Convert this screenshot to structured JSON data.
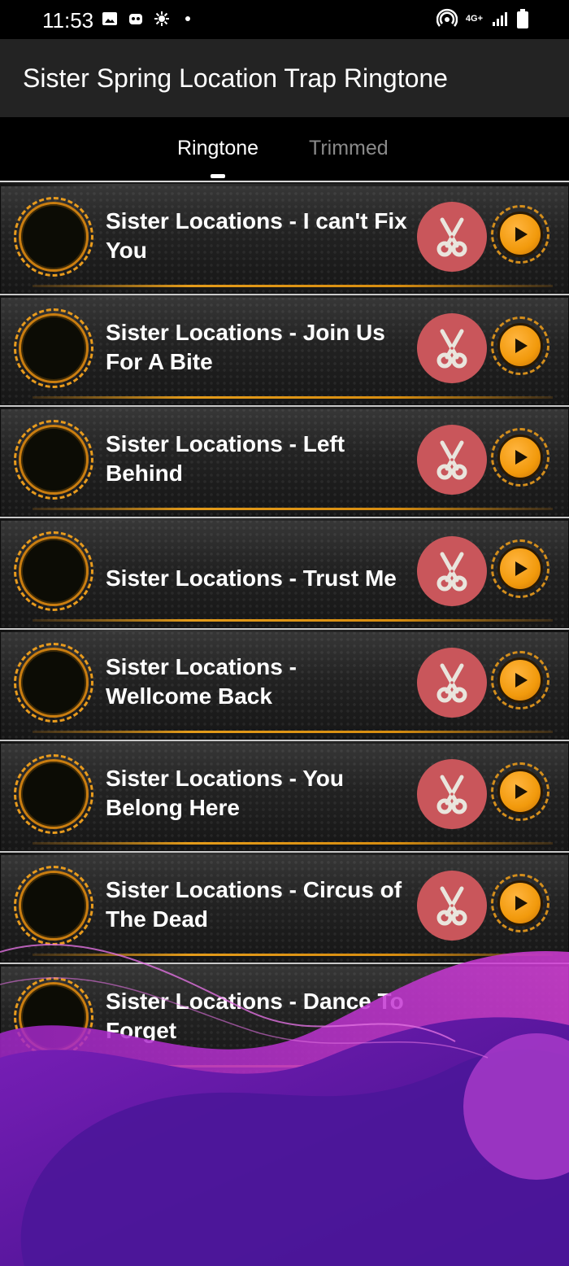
{
  "status_bar": {
    "time": "11:53",
    "network": "4G+"
  },
  "app": {
    "title": "Sister Spring Location Trap Ringtone"
  },
  "tabs": [
    {
      "label": "Ringtone",
      "active": true
    },
    {
      "label": "Trimmed",
      "active": false
    }
  ],
  "ringtones": [
    {
      "title": "Sister Locations - I can't Fix You"
    },
    {
      "title": "Sister Locations - Join Us For A Bite"
    },
    {
      "title": "Sister Locations - Left Behind"
    },
    {
      "title": "Sister Locations - Trust Me"
    },
    {
      "title": "Sister Locations - Wellcome Back"
    },
    {
      "title": "Sister Locations - You Belong Here"
    },
    {
      "title": "Sister Locations - Circus of The Dead"
    },
    {
      "title": "Sister Locations - Dance To Forget"
    }
  ],
  "icons": {
    "trim": "scissors-icon",
    "play": "play-icon"
  },
  "colors": {
    "accent_orange": "#f29a0c",
    "scissor_button": "#c9565b",
    "overlay_purple": "#5a1aa0"
  }
}
